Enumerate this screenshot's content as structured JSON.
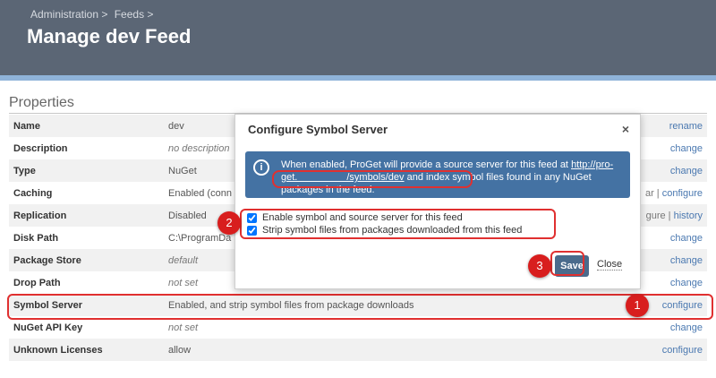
{
  "breadcrumb": {
    "items": [
      "Administration >",
      "Feeds >"
    ]
  },
  "page": {
    "title": "Manage dev Feed"
  },
  "properties": {
    "title": "Properties",
    "rows": [
      {
        "key": "Name",
        "value": "dev",
        "action": "rename"
      },
      {
        "key": "Description",
        "value": "no description",
        "action": "change"
      },
      {
        "key": "Type",
        "value": "NuGet",
        "action": "change"
      },
      {
        "key": "Caching",
        "value": "Enabled (conn",
        "action_prefix": "ar |",
        "action": "configure"
      },
      {
        "key": "Replication",
        "value": "Disabled",
        "action_prefix": "gure |",
        "action": "history"
      },
      {
        "key": "Disk Path",
        "value": "C:\\ProgramDa",
        "action": "change"
      },
      {
        "key": "Package Store",
        "value": "default",
        "action": "change"
      },
      {
        "key": "Drop Path",
        "value": "not set",
        "action": "change"
      },
      {
        "key": "Symbol Server",
        "value": "Enabled, and strip symbol files from package downloads",
        "action": "configure"
      },
      {
        "key": "NuGet API Key",
        "value": "not set",
        "action": "change"
      },
      {
        "key": "Unknown Licenses",
        "value": "allow",
        "action": "configure"
      }
    ]
  },
  "dialog": {
    "title": "Configure Symbol Server",
    "close_glyph": "×",
    "info": {
      "text_before": "When enabled, ProGet will provide a source server for this feed at",
      "link": "http://pro-get.     /symbols/dev",
      "text_after": "and index symbol files found in any NuGet packages in the feed."
    },
    "options": [
      {
        "label": "Enable symbol and source server for this feed",
        "checked": true
      },
      {
        "label": "Strip symbol files from packages downloaded from this feed",
        "checked": true
      }
    ],
    "save_label": "Save",
    "close_label": "Close"
  },
  "annotations": {
    "m1": "1",
    "m2": "2",
    "m3": "3"
  },
  "colors": {
    "header": "#5b6675",
    "accent": "#8fb3d9",
    "info": "#4472a3",
    "link": "#4a78b0",
    "highlight": "#e03030"
  }
}
